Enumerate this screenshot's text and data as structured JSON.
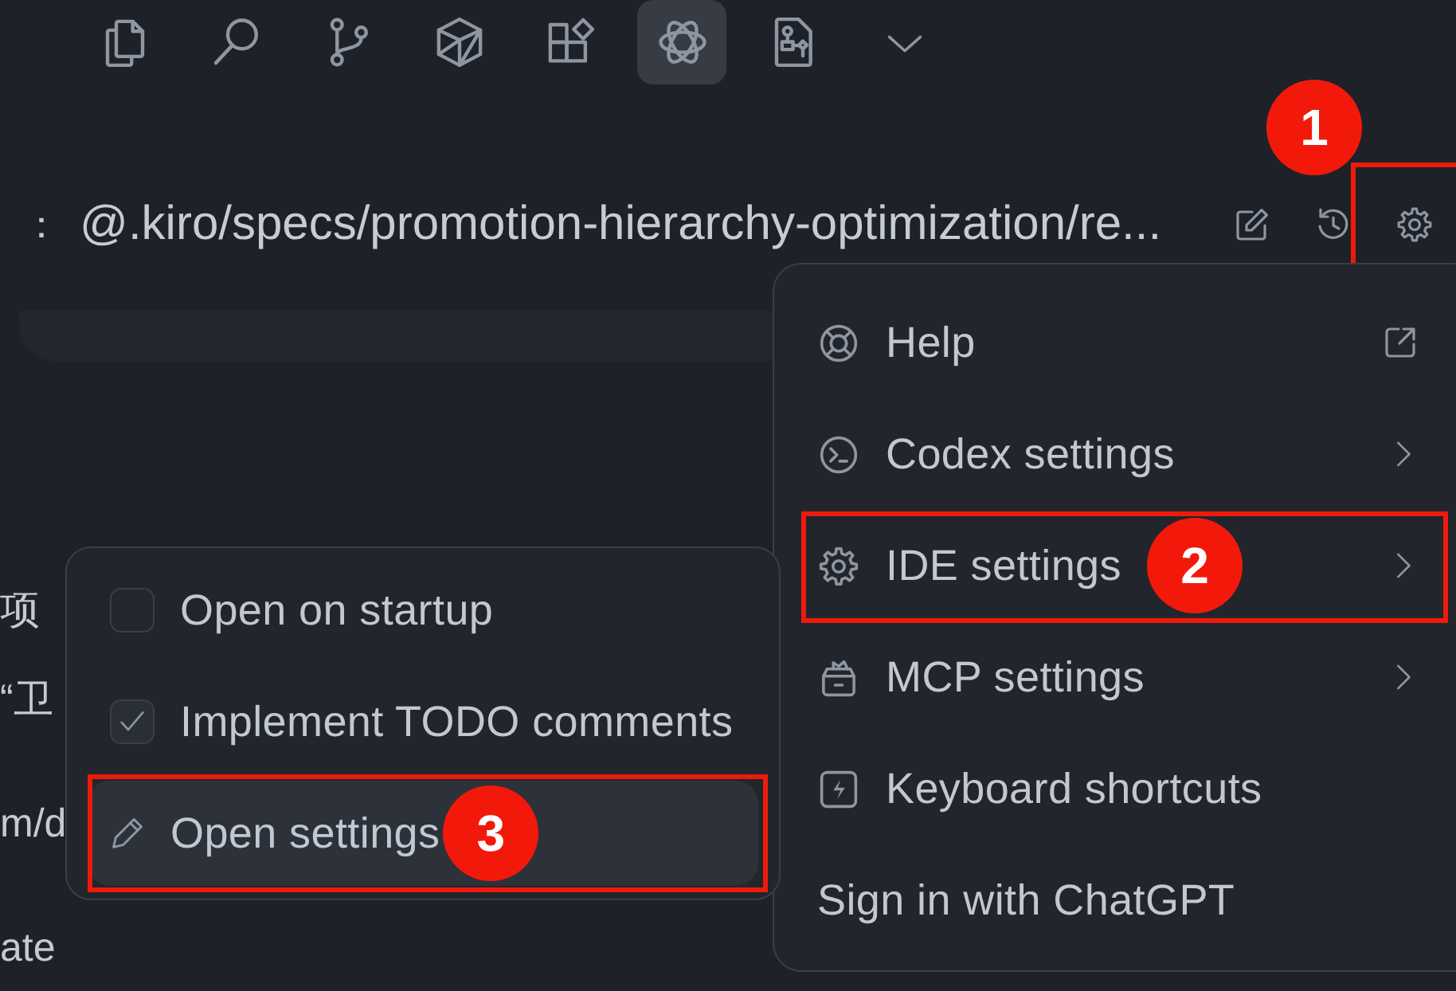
{
  "toolbar": {
    "items": [
      {
        "kind": "files",
        "selected": false
      },
      {
        "kind": "search",
        "selected": false
      },
      {
        "kind": "branch",
        "selected": false
      },
      {
        "kind": "cube",
        "selected": false
      },
      {
        "kind": "blocks",
        "selected": false
      },
      {
        "kind": "swirl",
        "selected": true
      },
      {
        "kind": "diagram",
        "selected": false
      },
      {
        "kind": "more",
        "selected": false
      }
    ]
  },
  "header": {
    "label": "：",
    "path": "@.kiro/specs/promotion-hierarchy-optimization/re...",
    "actions": [
      {
        "kind": "edit"
      },
      {
        "kind": "history"
      },
      {
        "kind": "settings",
        "callout": "1"
      }
    ]
  },
  "content": {
    "paragraphs": [
      [
        "项",
        "“卫"
      ],
      [
        "m/d"
      ],
      [
        "ate"
      ]
    ]
  },
  "menu": {
    "items": [
      {
        "kind": "help",
        "label": "Help",
        "external": true,
        "submenu": false,
        "selected": false
      },
      {
        "kind": "terminal",
        "label": "Codex settings",
        "external": false,
        "submenu": true,
        "selected": false
      },
      {
        "kind": "gear",
        "label": "IDE settings",
        "external": false,
        "submenu": true,
        "selected": false,
        "callout": "2"
      },
      {
        "kind": "box",
        "label": "MCP settings",
        "external": false,
        "submenu": true,
        "selected": false
      },
      {
        "kind": "bolt",
        "label": "Keyboard shortcuts",
        "external": false,
        "submenu": false,
        "selected": false
      },
      {
        "kind": "plain",
        "label": "Sign in with ChatGPT",
        "external": false,
        "submenu": false,
        "selected": false
      }
    ]
  },
  "submenu": {
    "items": [
      {
        "kind": "checkbox",
        "label": "Open on startup",
        "checked": false,
        "selected": false
      },
      {
        "kind": "checkbox",
        "label": "Implement TODO comments",
        "checked": true,
        "selected": false
      },
      {
        "kind": "action",
        "label": "Open settings",
        "selected": true,
        "callout": "3"
      }
    ]
  }
}
